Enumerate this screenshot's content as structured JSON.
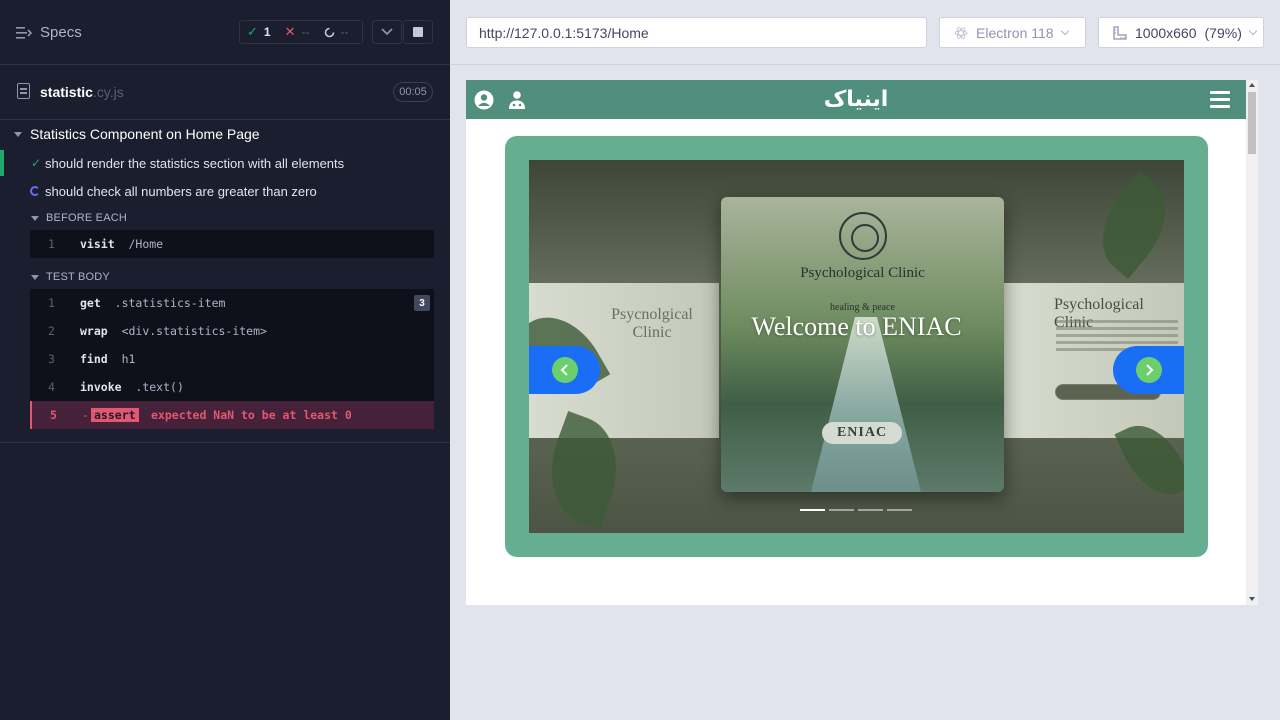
{
  "reporter": {
    "specs_label": "Specs",
    "stats": {
      "passed": "1",
      "failed": "--",
      "pending": "--"
    },
    "spec": {
      "name": "statistic",
      "ext": ".cy.js",
      "duration": "00:05"
    },
    "suite_title": "Statistics Component on Home Page",
    "tests": [
      {
        "label": "should render the statistics section with all elements",
        "state": "passed"
      },
      {
        "label": "should check all numbers are greater than zero",
        "state": "running"
      }
    ],
    "before_each_label": "BEFORE EACH",
    "before_each_commands": [
      {
        "idx": "1",
        "name": "visit",
        "message": "/Home"
      }
    ],
    "test_body_label": "TEST BODY",
    "body_commands": [
      {
        "idx": "1",
        "name": "get",
        "message": ".statistics-item",
        "badge": "3"
      },
      {
        "idx": "2",
        "name": "wrap",
        "message": "<div.statistics-item>"
      },
      {
        "idx": "3",
        "name": "find",
        "message": "h1"
      },
      {
        "idx": "4",
        "name": "invoke",
        "message": ".text()"
      },
      {
        "idx": "5",
        "dash": "-",
        "name": "assert",
        "message": "expected NaN to be at least 0"
      }
    ]
  },
  "toolbar": {
    "url": "http://127.0.0.1:5173/Home",
    "browser": "Electron 118",
    "viewport": "1000x660",
    "scale": "(79%)"
  },
  "site": {
    "brand": "اینیاک",
    "nav_color": "#4f8f7b",
    "card_color": "#66ae92",
    "slide": {
      "clinic_name": "Psychological Clinic",
      "tagline": "healing & peace",
      "title": "Welcome to ENIAC",
      "badge": "ENIAC",
      "left_card_text": "Psycnolgical Clinic",
      "right_card_text": "Psychological Clinic"
    },
    "dots_total": 4,
    "dot_active": 1
  }
}
